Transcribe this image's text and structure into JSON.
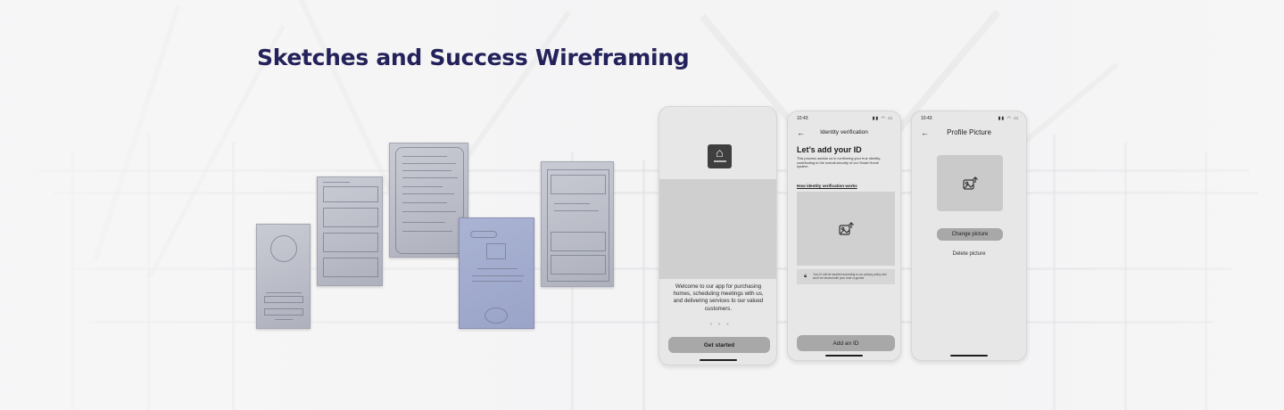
{
  "page": {
    "title": "Sketches and Success Wireframing"
  },
  "onboarding_screen": {
    "welcome_text": "Welcome to our app for purchasing homes, scheduling meetings with us, and delivering services to our valued customers.",
    "page_dots": "● ● ●",
    "cta_label": "Get started"
  },
  "identity_screen": {
    "status_time": "10:43",
    "status_icons": "▮▮ ◠ ▭",
    "header_title": "Identity verification",
    "heading": "Let’s add your ID",
    "description": "This process assists us in confirming your true identity, contributing to the overall security of our Smart Home system.",
    "link_label": "How identity verification works",
    "privacy_note": "Your ID will be handled according to our privacy policy and won’t be shared with your host or guests.",
    "cta_label": "Add an ID"
  },
  "profile_screen": {
    "status_time": "10:43",
    "status_icons": "▮▮ ◠ ▭",
    "header_title": "Profile Picture",
    "change_label": "Change picture",
    "delete_label": "Delete picture"
  },
  "icons": {
    "back": "arrow-left-icon",
    "upload": "image-upload-icon",
    "lock": "lock-icon",
    "home": "home-logo-icon"
  },
  "colors": {
    "title": "#24225a",
    "phone_bg": "#e7e7e7",
    "button": "#a8a8a8",
    "placeholder": "#cfcfcf"
  }
}
